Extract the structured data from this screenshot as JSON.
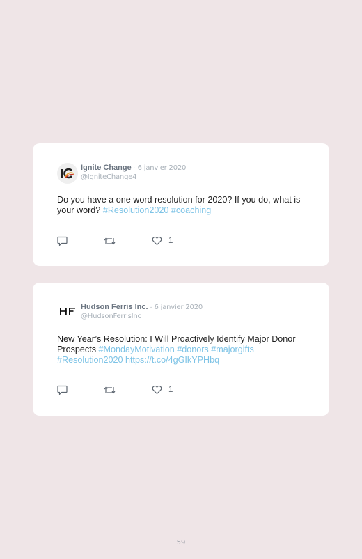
{
  "tweets": [
    {
      "name": "Ignite Change",
      "separator": " · ",
      "date": "6 janvier 2020",
      "handle": "@IgniteChange4",
      "avatar_icon": "ignite-change-logo",
      "text_parts": [
        {
          "text": "Do you have a one word resolution for 2020? If you do, what is your word? ",
          "type": "plain"
        },
        {
          "text": "#Resolution2020",
          "type": "link"
        },
        {
          "text": " ",
          "type": "plain"
        },
        {
          "text": "#coaching",
          "type": "link"
        }
      ],
      "likes": "1"
    },
    {
      "name": "Hudson Ferris Inc.",
      "separator": " · ",
      "date": "6 janvier 2020",
      "handle": "@HudsonFerrisInc",
      "avatar_icon": "hudson-ferris-logo",
      "avatar_text": "HF",
      "text_parts": [
        {
          "text": "New Year’s Resolution: I Will Proactively Identify Major Donor Prospects ",
          "type": "plain"
        },
        {
          "text": "#MondayMotivation",
          "type": "link"
        },
        {
          "text": " ",
          "type": "plain"
        },
        {
          "text": "#donors",
          "type": "link"
        },
        {
          "text": " ",
          "type": "plain"
        },
        {
          "text": "#majorgifts",
          "type": "link"
        },
        {
          "text": " ",
          "type": "plain"
        },
        {
          "text": "#Resolution2020",
          "type": "link"
        },
        {
          "text": " ",
          "type": "plain"
        },
        {
          "text": "https://t.co/4gGIkYPHbq",
          "type": "link"
        }
      ],
      "likes": "1"
    }
  ],
  "icons": {
    "reply": "speech-bubble-icon",
    "retweet": "retweet-icon",
    "like": "heart-icon"
  },
  "colors": {
    "background": "#efe5e7",
    "card": "#ffffff",
    "link": "#7dc3e6",
    "name": "#6a7480",
    "muted": "#a9b1b9"
  },
  "page_number": "59"
}
